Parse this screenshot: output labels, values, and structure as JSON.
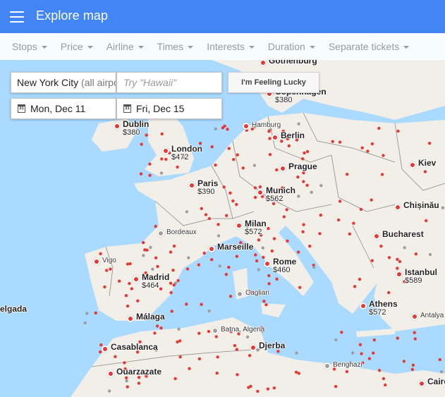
{
  "app": {
    "title": "Explore map"
  },
  "filters": [
    {
      "label": "Stops"
    },
    {
      "label": "Price"
    },
    {
      "label": "Airline"
    },
    {
      "label": "Times"
    },
    {
      "label": "Interests"
    },
    {
      "label": "Duration"
    },
    {
      "label": "Separate tickets"
    }
  ],
  "search": {
    "origin_value": "New York City",
    "origin_suffix": "(all airpo",
    "destination_placeholder": "Try \"Hawaii\"",
    "depart_date": "Mon, Dec 11",
    "return_date": "Fri, Dec 15",
    "calendar_icon_number": "31",
    "lucky_button": "I'm Feeling Lucky"
  },
  "colors": {
    "appbar": "#4285f4",
    "water": "#aadaff",
    "land": "#f2efe9",
    "pin_red": "#e53935",
    "pin_gray": "#9e9e9e"
  },
  "cities": [
    {
      "name": "Gothenburg",
      "price": "",
      "pin": "red"
    },
    {
      "name": "Copenhagen",
      "price": "$380",
      "pin": "red"
    },
    {
      "name": "Dublin",
      "price": "$380",
      "pin": "red"
    },
    {
      "name": "Hamburg",
      "price": "",
      "pin": "red",
      "small": true
    },
    {
      "name": "Berlin",
      "price": "",
      "pin": "red"
    },
    {
      "name": "London",
      "price": "$472",
      "pin": "red"
    },
    {
      "name": "Prague",
      "price": "",
      "pin": "red"
    },
    {
      "name": "Kiev",
      "price": "",
      "pin": "red"
    },
    {
      "name": "Paris",
      "price": "$390",
      "pin": "red"
    },
    {
      "name": "Munich",
      "price": "$562",
      "pin": "red"
    },
    {
      "name": "Chișinău",
      "price": "",
      "pin": "red"
    },
    {
      "name": "Milan",
      "price": "$572",
      "pin": "red"
    },
    {
      "name": "Bordeaux",
      "price": "",
      "pin": "gray",
      "small": true
    },
    {
      "name": "Bucharest",
      "price": "",
      "pin": "red"
    },
    {
      "name": "Marseille",
      "price": "",
      "pin": "red"
    },
    {
      "name": "Vigo",
      "price": "",
      "pin": "red"
    },
    {
      "name": "Rome",
      "price": "$460",
      "pin": "red"
    },
    {
      "name": "Istanbul",
      "price": "$589",
      "pin": "red"
    },
    {
      "name": "Madrid",
      "price": "$464",
      "pin": "red"
    },
    {
      "name": "Cagliari",
      "price": "",
      "pin": "gray",
      "small": true
    },
    {
      "name": "Athens",
      "price": "$572",
      "pin": "red"
    },
    {
      "name": "Antalya",
      "price": "",
      "pin": "red",
      "small": true
    },
    {
      "name": "Málaga",
      "price": "",
      "pin": "red"
    },
    {
      "name": "Batna, Algeria",
      "price": "",
      "pin": "gray",
      "small": true
    },
    {
      "name": "Djerba",
      "price": "",
      "pin": "red"
    },
    {
      "name": "Casablanca",
      "price": "",
      "pin": "red"
    },
    {
      "name": "Benghazi",
      "price": "",
      "pin": "gray",
      "small": true
    },
    {
      "name": "Ouarzazate",
      "price": "",
      "pin": "red"
    },
    {
      "name": "Cairo",
      "price": "",
      "pin": "red"
    }
  ],
  "edge_labels": [
    "elgada"
  ]
}
